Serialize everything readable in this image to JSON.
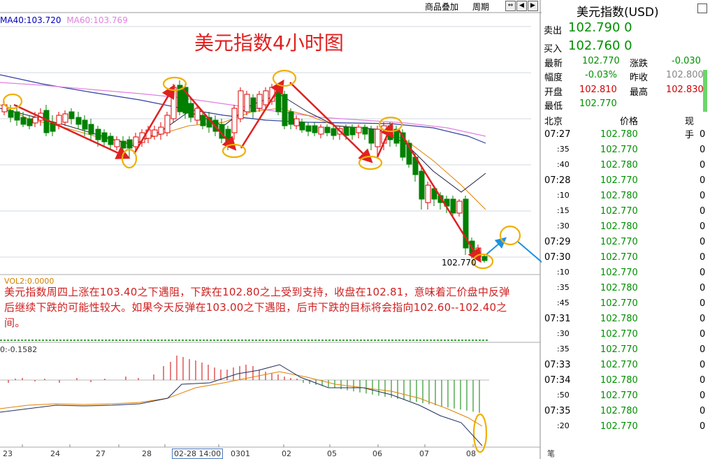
{
  "header": {
    "link_overlay": "商品叠加",
    "link_period": "周期",
    "nav_icons": [
      "arrow-left-right-icon",
      "arrow-left-icon",
      "arrow-right-icon"
    ]
  },
  "legend": {
    "ma40": "MA40:103.720",
    "ma60": "MA60:103.769",
    "ma40_color": "#0000c0",
    "ma60_color": "#e080e0"
  },
  "title": "美元指数4小时图",
  "vol_label": "VOL2:0.0000",
  "note": "美元指数周四上涨在103.40之下遇阻，下跌在102.80之上受到支持，收盘在102.81，意味着汇价盘中反弹后继续下跌的可能性较大。如果今天反弹在103.00之下遇阻，后市下跌的目标将会指向102.60--102.40之间。",
  "macd_label": "0:-0.1582",
  "last_price_tag": "102.770",
  "x_axis": {
    "labels": [
      "23",
      "24",
      "27",
      "28",
      "0301",
      "02",
      "05",
      "06",
      "07",
      "08"
    ],
    "cursor_label": "02-28 14:00"
  },
  "colors": {
    "up": "#e00000",
    "down": "#008000",
    "annotation_arrow": "#e02020",
    "forecast_arrow": "#2090e0",
    "highlight": "#f0b000"
  },
  "chart_data": {
    "type": "candlestick",
    "title": "美元指数4小时图",
    "series": [
      {
        "name": "MA40",
        "value": 103.72
      },
      {
        "name": "MA60",
        "value": 103.769
      }
    ],
    "last_price": 102.77
  },
  "panel": {
    "title": "美元指数(USD)",
    "sell_label": "卖出",
    "sell_value": "102.790 0",
    "buy_label": "买入",
    "buy_value": "102.760 0",
    "stats": [
      {
        "label": "最新",
        "value": "102.770",
        "color": "green"
      },
      {
        "label": "涨跌",
        "value": "-0.030",
        "color": "green"
      },
      {
        "label": "幅度",
        "value": "-0.03%",
        "color": "green"
      },
      {
        "label": "昨收",
        "value": "102.800",
        "color": "gray"
      },
      {
        "label": "开盘",
        "value": "102.810",
        "color": "red"
      },
      {
        "label": "最高",
        "value": "102.830",
        "color": "red"
      },
      {
        "label": "最低",
        "value": "102.770",
        "color": "green"
      }
    ],
    "ticks_header": {
      "place": "北京",
      "price": "价格",
      "volume": "现手"
    },
    "ticks": [
      {
        "time": "07:27",
        "price": "102.780",
        "vol": "0"
      },
      {
        "time": ":35",
        "price": "102.770",
        "vol": "0"
      },
      {
        "time": ":40",
        "price": "102.780",
        "vol": "0"
      },
      {
        "time": "07:28",
        "price": "102.770",
        "vol": "0"
      },
      {
        "time": ":10",
        "price": "102.780",
        "vol": "0"
      },
      {
        "time": ":15",
        "price": "102.770",
        "vol": "0"
      },
      {
        "time": ":30",
        "price": "102.780",
        "vol": "0"
      },
      {
        "time": "07:29",
        "price": "102.770",
        "vol": "0"
      },
      {
        "time": "07:30",
        "price": "102.770",
        "vol": "0"
      },
      {
        "time": ":10",
        "price": "102.770",
        "vol": "0"
      },
      {
        "time": ":35",
        "price": "102.780",
        "vol": "0"
      },
      {
        "time": ":45",
        "price": "102.770",
        "vol": "0"
      },
      {
        "time": "07:31",
        "price": "102.780",
        "vol": "0"
      },
      {
        "time": ":30",
        "price": "102.770",
        "vol": "0"
      },
      {
        "time": ":35",
        "price": "102.770",
        "vol": "0"
      },
      {
        "time": "07:33",
        "price": "102.770",
        "vol": "0"
      },
      {
        "time": "07:34",
        "price": "102.780",
        "vol": "0"
      },
      {
        "time": ":50",
        "price": "102.770",
        "vol": "0"
      },
      {
        "time": "07:35",
        "price": "102.780",
        "vol": "0"
      },
      {
        "time": ":20",
        "price": "102.770",
        "vol": "0"
      }
    ],
    "footer": "笔"
  }
}
